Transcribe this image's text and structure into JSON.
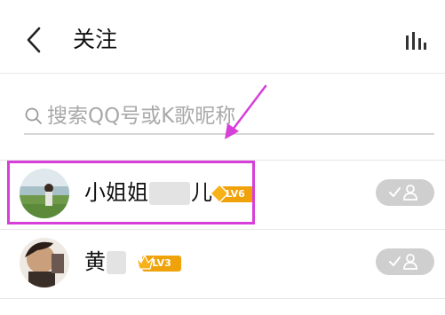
{
  "header": {
    "title": "关注",
    "back_icon": "chevron-left-icon",
    "stats_icon": "bar-chart-icon"
  },
  "search": {
    "placeholder": "搜索QQ号或K歌昵称",
    "icon": "search-icon"
  },
  "follow_list": [
    {
      "name_visible_start": "小姐姐",
      "name_visible_end": "儿",
      "level_badge": "LV6",
      "level_badge_color": "#f0a20b",
      "follow_status_icon": "check-user-icon"
    },
    {
      "name_visible_start": "黄",
      "level_badge": "LV3",
      "level_badge_color": "#f0a20b",
      "follow_status_icon": "check-user-icon"
    }
  ],
  "annotation": {
    "highlight_color": "#d63fd8",
    "arrow_color": "#d63fd8"
  }
}
